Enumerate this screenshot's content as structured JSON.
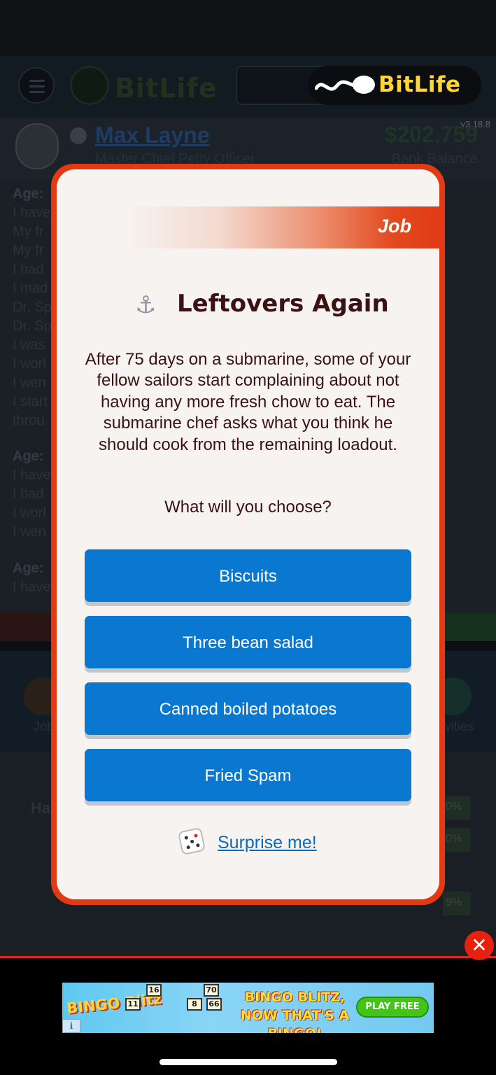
{
  "background_app": {
    "brand": "BitLife",
    "version": "v3.18.8",
    "character_name": "Max Layne",
    "job_title": "Master Chief Petty Officer",
    "bank_balance": "$202,759",
    "bank_balance_label": "Bank Balance",
    "log_lines": [
      "Age:",
      "I have",
      "My fr",
      "My fr",
      "I had",
      "I mad",
      "Dr. Sp",
      "Dr. Sp",
      "I was",
      "I worl",
      "I wen",
      "I start",
      "throu",
      "Age:",
      "I have",
      "I had",
      "I worl",
      "I wen",
      "Age:",
      "I have"
    ],
    "action_labels": [
      "Job",
      "vities"
    ],
    "stat_label": "Ha",
    "stat_values": [
      "0%",
      "0%",
      "9%"
    ]
  },
  "modal": {
    "category": "Job",
    "icon": "anchor-icon",
    "title": "Leftovers Again",
    "body": "After 75 days on a submarine, some of your fellow sailors start complaining about not having any more fresh chow to eat. The submarine chef asks what you think he should cook from the remaining loadout.",
    "prompt": "What will you choose?",
    "choices": [
      "Biscuits",
      "Three bean salad",
      "Canned boiled potatoes",
      "Fried Spam"
    ],
    "surprise_label": "Surprise me!"
  },
  "ad": {
    "close_label": "✕",
    "brand": "BINGO Blitz",
    "headline": "BINGO BLITZ, NOW THAT'S A BINGO!",
    "cta": "PLAY FREE",
    "info": "i",
    "tiles": [
      "16",
      "70",
      "11",
      "8",
      "66"
    ]
  },
  "colors": {
    "modal_frame": "#e23a14",
    "modal_bg": "#f6f3f1",
    "title_text": "#3a1114",
    "choice_button": "#0a78d0",
    "link": "#0b6bb8",
    "brand_yellow": "#ffd633"
  }
}
